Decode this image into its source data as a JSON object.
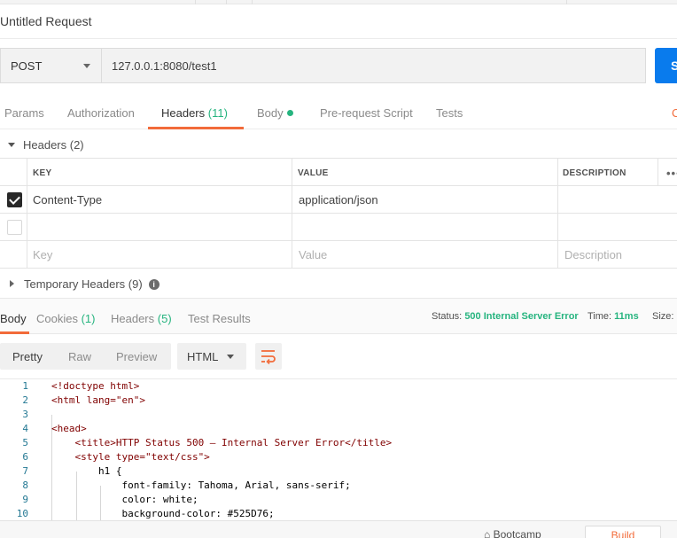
{
  "request": {
    "title": "Untitled Request",
    "method": "POST",
    "url": "127.0.0.1:8080/test1",
    "send_label": "S"
  },
  "request_tabs": [
    {
      "label": "Params",
      "count": ""
    },
    {
      "label": "Authorization",
      "count": ""
    },
    {
      "label": "Headers",
      "count": "(11)"
    },
    {
      "label": "Body",
      "count": ""
    },
    {
      "label": "Pre-request Script",
      "count": ""
    },
    {
      "label": "Tests",
      "count": ""
    }
  ],
  "cookies_link": "C",
  "headers_section": {
    "title": "Headers (2)",
    "columns": {
      "key": "KEY",
      "value": "VALUE",
      "description": "DESCRIPTION"
    },
    "rows": [
      {
        "checked": true,
        "key": "Content-Type",
        "value": "application/json",
        "description": ""
      },
      {
        "checked": false,
        "key": "",
        "value": "",
        "description": ""
      }
    ],
    "placeholders": {
      "key": "Key",
      "value": "Value",
      "description": "Description"
    },
    "more": "•••"
  },
  "temporary_headers": {
    "title": "Temporary Headers (9)",
    "info": "i"
  },
  "response_tabs": [
    {
      "label": "Body",
      "count": ""
    },
    {
      "label": "Cookies",
      "count": "(1)"
    },
    {
      "label": "Headers",
      "count": "(5)"
    },
    {
      "label": "Test Results",
      "count": ""
    }
  ],
  "response_status": {
    "status_label": "Status:",
    "status_value": "500 Internal Server Error",
    "time_label": "Time:",
    "time_value": "11ms",
    "size_label": "Size:"
  },
  "view_modes": [
    "Pretty",
    "Raw",
    "Preview"
  ],
  "language": "HTML",
  "code_lines": [
    "<!doctype html>",
    "<html lang=\"en\">",
    "",
    "<head>",
    "    <title>HTTP Status 500 – Internal Server Error</title>",
    "    <style type=\"text/css\">",
    "        h1 {",
    "            font-family: Tahoma, Arial, sans-serif;",
    "            color: white;",
    "            background-color: #525D76;"
  ],
  "footer": {
    "bootcamp": "Bootcamp",
    "build": "Build"
  },
  "colors": {
    "accent": "#f26b3a",
    "success": "#26b47f",
    "send": "#097bed"
  }
}
